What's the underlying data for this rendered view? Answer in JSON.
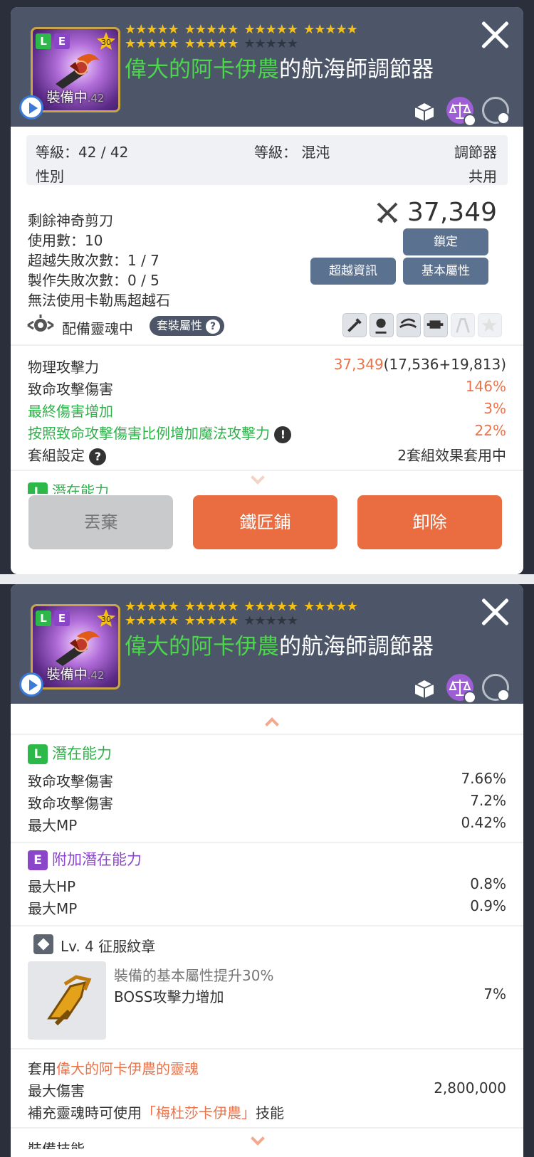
{
  "item": {
    "tag_l": "L",
    "tag_e": "E",
    "star_level": "30",
    "title_green": "偉大的阿卡伊農",
    "title_rest": "的航海師調節器",
    "equipped_label": "裝備中",
    "equipped_num": ".42",
    "stars_row1": [
      "★★★★★",
      "★★★★★",
      "★★★★★",
      "★★★★★"
    ],
    "stars_row2": [
      "★★★★★",
      "★★★★★"
    ],
    "stars_row2_dim": "★★★★★"
  },
  "info": {
    "level_label": "等級：42 / 42",
    "grade_label": "等級： 混沌",
    "type_label": "調節器",
    "gender_label": "性別",
    "gender_value": "共用"
  },
  "stats_top": {
    "scissors": "剩餘神奇剪刀",
    "uses": "使用數：10",
    "exceed_fail": "超越失敗次數：1 / 7",
    "craft_fail": "製作失敗次數：0 / 5",
    "no_stone": "無法使用卡勒馬超越石",
    "power": "37,349",
    "lock_btn": "鎖定",
    "exceed_btn": "超越資訊",
    "base_btn": "基本屬性"
  },
  "soul": {
    "label": "配備靈魂中",
    "set_badge": "套裝屬性"
  },
  "attrs": [
    {
      "name": "物理攻擊力",
      "value_orange": "37,349",
      "value_rest": "(17,536+19,813)",
      "color": "normal"
    },
    {
      "name": "致命攻擊傷害",
      "value_orange": "146%",
      "value_rest": "",
      "color": "normal"
    },
    {
      "name": "最終傷害增加",
      "value_orange": "3%",
      "value_rest": "",
      "color": "green"
    },
    {
      "name": "按照致命攻擊傷害比例增加魔法攻擊力",
      "value_orange": "22%",
      "value_rest": "",
      "color": "green"
    }
  ],
  "set_setting": {
    "label": "套組設定",
    "value": "2套組效果套用中"
  },
  "potential_peek": "潛在能力",
  "buttons": {
    "discard": "丟棄",
    "smith": "鐵匠鋪",
    "unequip": "卸除"
  },
  "potential": {
    "title": "潛在能力",
    "lines": [
      {
        "name": "致命攻擊傷害",
        "value": "7.66%"
      },
      {
        "name": "致命攻擊傷害",
        "value": "7.2%"
      },
      {
        "name": "最大MP",
        "value": "0.42%"
      }
    ]
  },
  "add_potential": {
    "title": "附加潛在能力",
    "lines": [
      {
        "name": "最大HP",
        "value": "0.8%"
      },
      {
        "name": "最大MP",
        "value": "0.9%"
      }
    ]
  },
  "emblem": {
    "title": "Lv. 4 征服紋章",
    "line1": "裝備的基本屬性提升30%",
    "line2": "BOSS攻擊力增加",
    "line2_value": "7%"
  },
  "soul_apply": {
    "prefix": "套用",
    "soul_name": "偉大的阿卡伊農的靈魂",
    "max_dmg_label": "最大傷害",
    "max_dmg_value": "2,800,000",
    "skill_prefix": "補充靈魂時可使用",
    "skill_name": "「梅杜莎卡伊農」",
    "skill_suffix": "技能"
  },
  "equip_skill_peek": "裝備技能",
  "colors": {
    "header": "#4d5669",
    "orange": "#e9734a",
    "green": "#2fb24a",
    "purple": "#8b46c9",
    "gold": "#f5c016"
  }
}
